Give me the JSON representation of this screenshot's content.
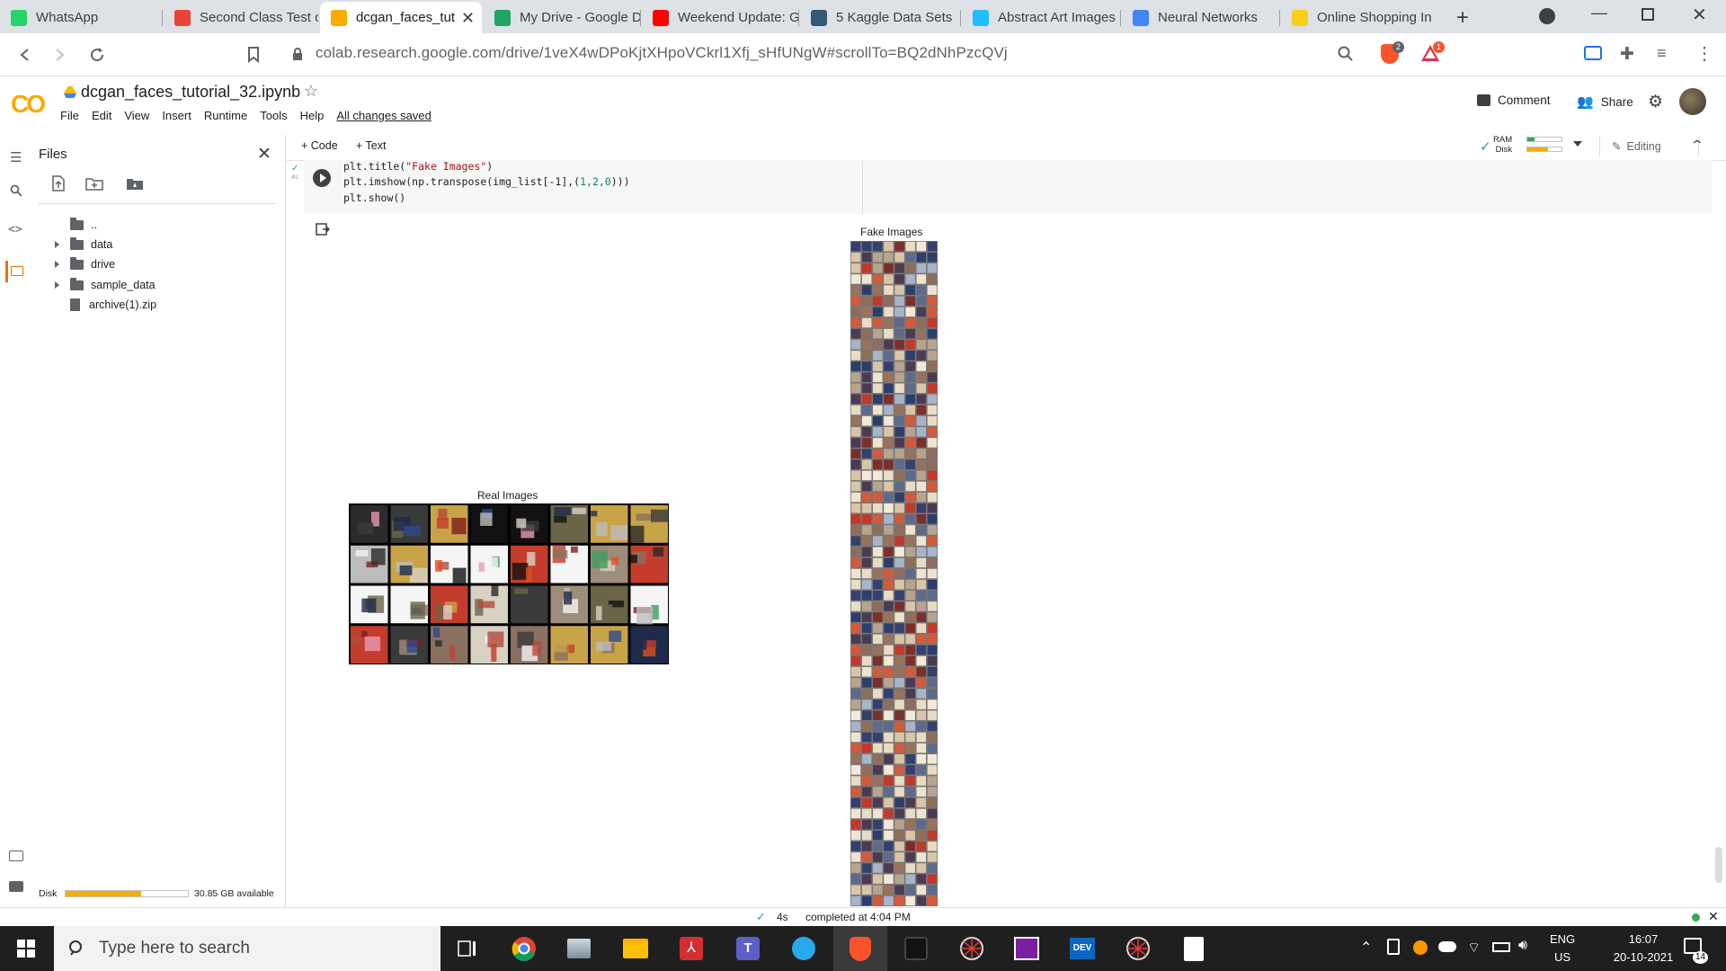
{
  "browser": {
    "tabs": [
      {
        "label": "WhatsApp",
        "icon": "whatsapp-icon",
        "color": "#25d366"
      },
      {
        "label": "Second Class Test o",
        "icon": "gmail-icon",
        "color": "#ea4335"
      },
      {
        "label": "dcgan_faces_tut",
        "icon": "colab-icon",
        "color": "#f9ab00",
        "active": true
      },
      {
        "label": "My Drive - Google D",
        "icon": "drive-icon",
        "color": "#1fa463"
      },
      {
        "label": "Weekend Update: G",
        "icon": "youtube-icon",
        "color": "#ff0000"
      },
      {
        "label": "5 Kaggle Data Sets",
        "icon": "tds-icon",
        "color": "#355876"
      },
      {
        "label": "Abstract Art Images",
        "icon": "kaggle-icon",
        "color": "#20beff"
      },
      {
        "label": "Neural Networks",
        "icon": "neural-icon",
        "color": "#4285f4"
      },
      {
        "label": "Online Shopping In",
        "icon": "flipkart-icon",
        "color": "#f7d117"
      }
    ],
    "url": "colab.research.google.com/drive/1veX4wDPoKjtXHpoVCkrl1Xfj_sHfUNgW#scrollTo=BQ2dNhPzcQVj",
    "brave_badge": "2",
    "alert_badge": "1"
  },
  "colab": {
    "logo": "CO",
    "notebook_title": "dcgan_faces_tutorial_32.ipynb",
    "menus": [
      "File",
      "Edit",
      "View",
      "Insert",
      "Runtime",
      "Tools",
      "Help"
    ],
    "saved_status": "All changes saved",
    "comment_label": "Comment",
    "share_label": "Share",
    "add_code": "+ Code",
    "add_text": "+ Text",
    "ram_label": "RAM",
    "disk_label": "Disk",
    "editing_label": "Editing"
  },
  "files_panel": {
    "title": "Files",
    "parent_dir": "..",
    "items": [
      {
        "name": "data",
        "type": "folder"
      },
      {
        "name": "drive",
        "type": "folder"
      },
      {
        "name": "sample_data",
        "type": "folder"
      },
      {
        "name": "archive(1).zip",
        "type": "file"
      }
    ],
    "disk_label": "Disk",
    "disk_available": "30.85 GB available",
    "disk_usage": 0.62
  },
  "cell": {
    "exec_time": "4s",
    "code_lines": [
      {
        "pre": "plt.title(",
        "str": "\"Fake Images\"",
        "post": ")"
      },
      {
        "pre": "plt.imshow(np.transpose(img_list[-1],(",
        "nums": "1,2,0",
        "post": ")))"
      },
      {
        "pre": "plt.show()",
        "str": "",
        "post": ""
      }
    ]
  },
  "output": {
    "real_title": "Real Images",
    "fake_title": "Fake Images"
  },
  "status": {
    "time": "4s",
    "completed": "completed at 4:04 PM"
  },
  "taskbar": {
    "search_placeholder": "Type here to search",
    "lang": "ENG",
    "region": "US",
    "clock_time": "16:07",
    "clock_date": "20-10-2021",
    "notif_count": "14"
  }
}
